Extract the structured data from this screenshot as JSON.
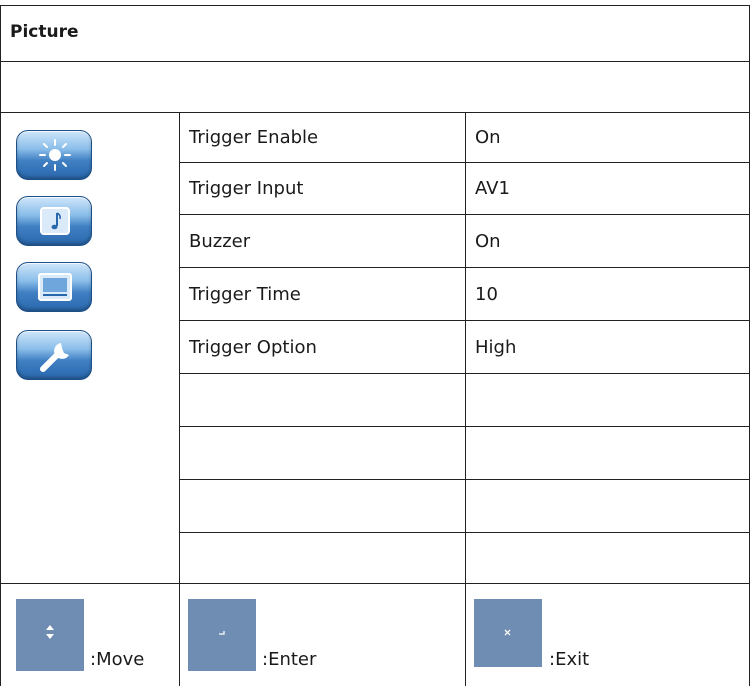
{
  "header": {
    "title": "Picture"
  },
  "menu": {
    "rows": [
      {
        "label": "Trigger Enable",
        "value": "On"
      },
      {
        "label": "Trigger Input",
        "value": "AV1"
      },
      {
        "label": "Buzzer",
        "value": "On"
      },
      {
        "label": "Trigger Time",
        "value": "10"
      },
      {
        "label": "Trigger Option",
        "value": "High"
      },
      {
        "label": "",
        "value": ""
      },
      {
        "label": "",
        "value": ""
      },
      {
        "label": "",
        "value": ""
      },
      {
        "label": "",
        "value": ""
      }
    ],
    "icons": [
      "sun-icon",
      "music-note-icon",
      "screen-icon",
      "wrench-icon"
    ]
  },
  "footer": {
    "move_label": ":Move",
    "enter_label": ":Enter",
    "exit_label": ":Exit"
  },
  "colors": {
    "icon_blue": "#3f7fc2",
    "key_box": "#6f8db2",
    "border": "#222222"
  }
}
